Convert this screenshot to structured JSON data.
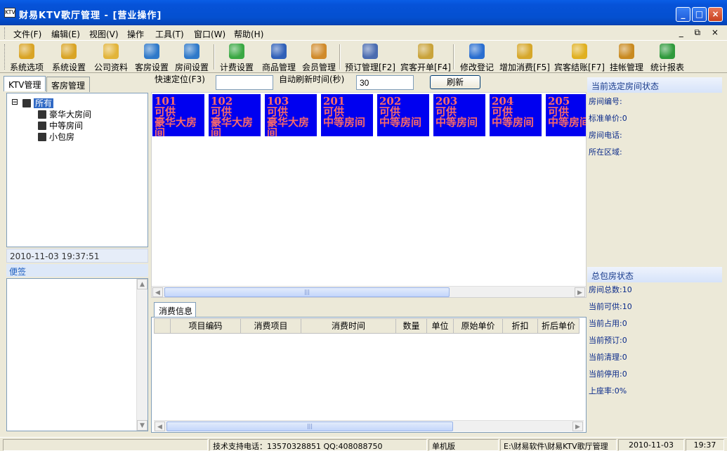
{
  "window": {
    "title": "财易KTV歌厅管理 - [营业操作]",
    "icon_text": "KTV"
  },
  "window_buttons": {
    "minimize": "_",
    "maximize": "□",
    "close": "×"
  },
  "menu": {
    "items": [
      "文件(F)",
      "编辑(E)",
      "视图(V)",
      "操作",
      "工具(T)",
      "窗口(W)",
      "帮助(H)"
    ],
    "mdi_controls": "_ ⧉ ×"
  },
  "toolbar": {
    "buttons": [
      {
        "label": "系统选项",
        "icon": "key-icon",
        "color": "#d9a425"
      },
      {
        "label": "系统设置",
        "icon": "key-icon",
        "color": "#d9a425"
      },
      {
        "label": "公司资料",
        "icon": "folder-icon",
        "color": "#e2b43a"
      },
      {
        "label": "客房设置",
        "icon": "building-icon",
        "color": "#2f79c9"
      },
      {
        "label": "房间设置",
        "icon": "building-icon",
        "color": "#2f79c9"
      },
      {
        "label": "计费设置",
        "icon": "money-icon",
        "color": "#3aa843"
      },
      {
        "label": "商品管理",
        "icon": "box-icon",
        "color": "#3060b8"
      },
      {
        "label": "会员管理",
        "icon": "person-icon",
        "color": "#d08a2a"
      },
      {
        "label": "预订管理[F2]",
        "icon": "stapler-icon",
        "color": "#4a6bb0"
      },
      {
        "label": "宾客开单[F4]",
        "icon": "gift-icon",
        "color": "#c9a33a"
      },
      {
        "label": "修改登记",
        "icon": "user-edit-icon",
        "color": "#2a6ed0"
      },
      {
        "label": "增加消费[F5]",
        "icon": "add-money-icon",
        "color": "#d6a72a"
      },
      {
        "label": "宾客结账[F7]",
        "icon": "coin-icon",
        "color": "#e0b020"
      },
      {
        "label": "挂帐管理",
        "icon": "moneybag-icon",
        "color": "#c98a20"
      },
      {
        "label": "统计报表",
        "icon": "chart-icon",
        "color": "#2f9a3c"
      }
    ]
  },
  "left": {
    "tabs": [
      "KTV管理",
      "客房管理"
    ],
    "tree": {
      "root": "所有",
      "children": [
        "豪华大房间",
        "中等房间",
        "小包房"
      ],
      "collapse_glyph": "⊟"
    },
    "datetime": "2010-11-03  19:37:51",
    "notes_title": "便签"
  },
  "center": {
    "quick_locate_label": "快速定位(F3)",
    "quick_locate_value": "",
    "auto_refresh_label": "自动刷新时间(秒)",
    "auto_refresh_value": "30",
    "refresh_button": "刷新",
    "rooms": [
      {
        "number": "101",
        "status": "可供",
        "type": "豪华大房间"
      },
      {
        "number": "102",
        "status": "可供",
        "type": "豪华大房间"
      },
      {
        "number": "103",
        "status": "可供",
        "type": "豪华大房间"
      },
      {
        "number": "201",
        "status": "可供",
        "type": "中等房间"
      },
      {
        "number": "202",
        "status": "可供",
        "type": "中等房间"
      },
      {
        "number": "203",
        "status": "可供",
        "type": "中等房间"
      },
      {
        "number": "204",
        "status": "可供",
        "type": "中等房间"
      },
      {
        "number": "205",
        "status": "可供",
        "type": "中等房间"
      }
    ],
    "consume_tab": "消费信息",
    "columns": [
      "",
      "项目编码",
      "消费项目",
      "消费时间",
      "数量",
      "单位",
      "原始单价",
      "折扣",
      "折后单价"
    ],
    "scroll_thumb_glyph": "|||"
  },
  "right": {
    "selected_title": "当前选定房间状态",
    "selected_lines": [
      "房间编号:",
      "标准单价:0",
      "房间电话:",
      "所在区域:"
    ],
    "summary_title": "总包房状态",
    "summary_lines": [
      "房间总数:10",
      "当前可供:10",
      "当前占用:0",
      "当前预订:0",
      "当前清理:0",
      "当前停用:0",
      "上座率:0%"
    ]
  },
  "status": {
    "support": "技术支持电话：13570328851 QQ:408088750",
    "edition": "单机版",
    "path": "E:\\财易软件\\财易KTV歌厅管理",
    "date": "2010-11-03",
    "time": "19:37"
  },
  "colors": {
    "room_bg": "#0000f0",
    "room_text": "#f86a6a",
    "titlebar": "#0450d0"
  }
}
